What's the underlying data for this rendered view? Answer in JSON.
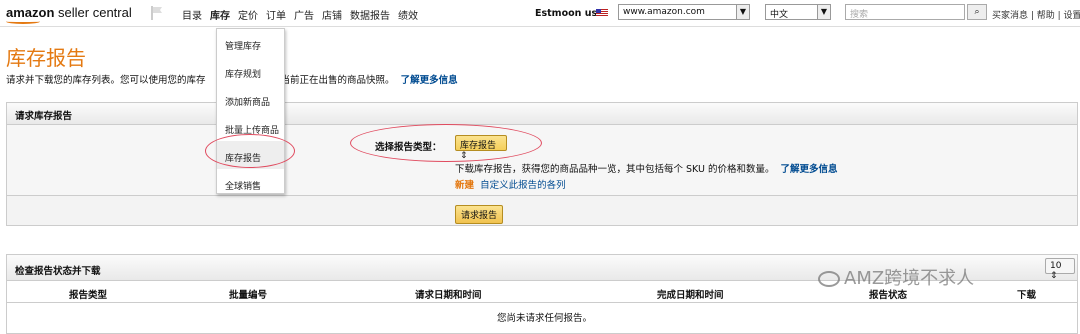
{
  "header": {
    "logo_main": "amazon",
    "logo_sub": "seller central",
    "nav": [
      "目录",
      "库存",
      "定价",
      "订单",
      "广告",
      "店铺",
      "数据报告",
      "绩效"
    ],
    "active_nav": "库存",
    "user": "Estmoon us",
    "marketplace": "www.amazon.com",
    "language": "中文",
    "search_placeholder": "搜索",
    "links": "买家消息 | 帮助 | 设置"
  },
  "menu": {
    "items": [
      "管理库存",
      "库存规划",
      "添加新商品",
      "批量上传商品",
      "库存报告",
      "全球销售"
    ],
    "highlighted": "库存报告"
  },
  "page": {
    "title": "库存报告",
    "description": "请求并下载您的库存列表。您可以使用您的库存",
    "description_end": "当前正在出售的商品快照。",
    "learn_more": "了解更多信息"
  },
  "request_panel": {
    "title": "请求库存报告",
    "type_label": "选择报告类型：",
    "type_value": "库存报告",
    "help_text": "下载库存报告，获得您的商品品种一览，其中包括每个 SKU 的价格和数量。",
    "help_link": "了解更多信息",
    "new_badge": "新建",
    "custom_link": "自定义此报告的各列",
    "submit_label": "请求报告"
  },
  "status_panel": {
    "title": "检查报告状态并下载",
    "per_page": "10",
    "columns": [
      "报告类型",
      "批量编号",
      "请求日期和时间",
      "完成日期和时间",
      "报告状态",
      "下载"
    ],
    "empty_text": "您尚未请求任何报告。"
  },
  "watermark": "AMZ跨境不求人",
  "colors": {
    "accent": "#e47911",
    "link": "#004b91",
    "annotation": "#e04b5f"
  }
}
